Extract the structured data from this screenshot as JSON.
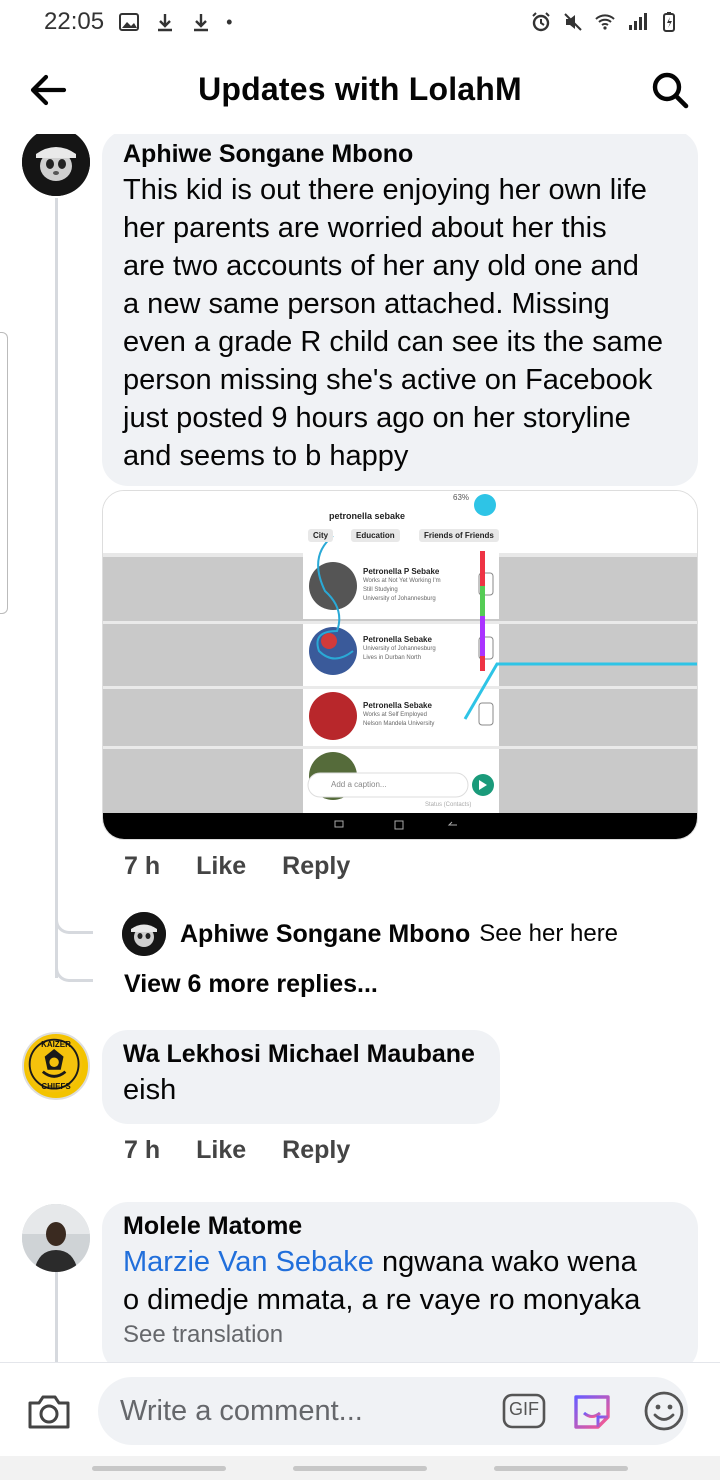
{
  "status_bar": {
    "time": "22:05",
    "dot": "•"
  },
  "header": {
    "title": "Updates with LolahM"
  },
  "comments": [
    {
      "author": "Aphiwe Songane Mbono",
      "text_lines": [
        "This kid is out there enjoying her own life",
        "her parents are worried about her this",
        "are two accounts of her any old one and",
        "a new same person attached. Missing",
        "even a grade R child can see its the same",
        "person missing she's active on Facebook",
        "just posted 9 hours ago on her storyline",
        "and seems to b happy"
      ],
      "time": "7 h",
      "like": "Like",
      "reply": "Reply",
      "attached_screenshot": {
        "search_title": "petronella sebake",
        "filters": [
          "City",
          "Education",
          "Friends of Friends"
        ],
        "battery": "63%",
        "results": [
          {
            "name": "Petronella P Sebake",
            "lines": [
              "Works at Not Yet Working I'm",
              "Still Studying",
              "University of Johannesburg"
            ]
          },
          {
            "name": "Petronella Sebake",
            "lines": [
              "University of Johannesburg",
              "Lives in Durban North"
            ]
          },
          {
            "name": "Petronella Sebake",
            "lines": [
              "Works at Self Employed",
              "Nelson Mandela University"
            ]
          }
        ],
        "caption_placeholder": "Add a caption...",
        "status_text": "Status (Contacts)"
      },
      "replies_preview": {
        "author": "Aphiwe Songane Mbono",
        "text": "See her here",
        "view_more": "View 6 more replies..."
      }
    },
    {
      "author": "Wa Lekhosi Michael Maubane",
      "text_lines": [
        "eish"
      ],
      "time": "7 h",
      "like": "Like",
      "reply": "Reply",
      "avatar_text": [
        "KAIZER",
        "CHIEFS"
      ]
    },
    {
      "author": "Molele Matome",
      "mention": "Marzie Van Sebake",
      "text_after_mention": " ngwana wako wena",
      "text_lines": [
        "o dimedje mmata, a re vaye ro monyaka"
      ],
      "see_translation": "See translation"
    }
  ],
  "composer": {
    "placeholder": "Write a comment...",
    "gif_label": "GIF"
  },
  "colors": {
    "bubble": "#f0f2f5",
    "link": "#216fdb",
    "accent": "#1877f2"
  }
}
